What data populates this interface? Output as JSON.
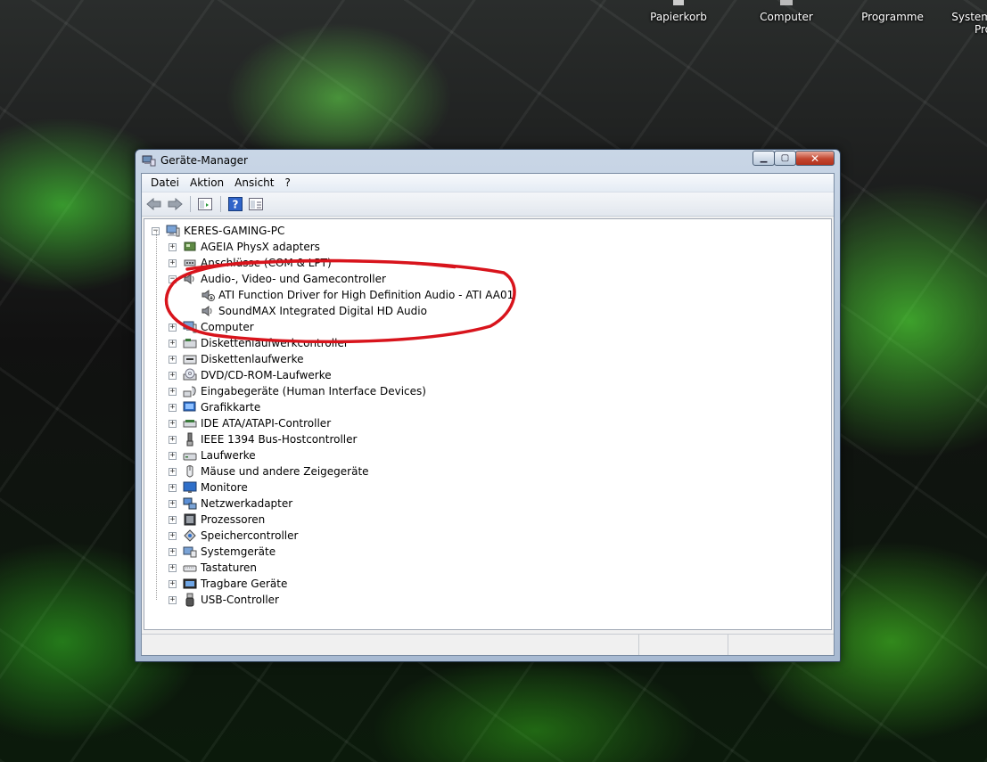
{
  "desktop": {
    "icons": [
      {
        "label": "Papierkorb",
        "icon": "recycle-bin-icon"
      },
      {
        "label": "Computer",
        "icon": "computer-icon"
      },
      {
        "label": "Programme",
        "icon": "folder-icon"
      },
      {
        "label": "System",
        "label2": "Pro",
        "icon": "system-icon"
      }
    ]
  },
  "window": {
    "title": "Geräte-Manager",
    "menu": [
      "Datei",
      "Aktion",
      "Ansicht",
      "?"
    ],
    "toolbar": [
      "back-arrow-icon",
      "forward-arrow-icon",
      "properties-icon",
      "help-icon",
      "view-icon"
    ]
  },
  "tree": {
    "root": "KERES-GAMING-PC",
    "items": [
      {
        "label": "AGEIA PhysX adapters",
        "expander": "+",
        "icon": "physx-adapter-icon"
      },
      {
        "label": "Anschlüsse (COM & LPT)",
        "expander": "+",
        "icon": "port-icon"
      },
      {
        "label": "Audio-, Video- und Gamecontroller",
        "expander": "-",
        "icon": "speaker-icon",
        "children": [
          {
            "label": "ATI Function Driver for High Definition Audio - ATI AA01",
            "icon": "audio-driver-icon"
          },
          {
            "label": "SoundMAX Integrated Digital HD Audio",
            "icon": "speaker-icon"
          }
        ]
      },
      {
        "label": "Computer",
        "expander": "+",
        "icon": "computer-icon"
      },
      {
        "label": "Diskettenlaufwerkcontroller",
        "expander": "+",
        "icon": "floppy-controller-icon"
      },
      {
        "label": "Diskettenlaufwerke",
        "expander": "+",
        "icon": "floppy-drive-icon"
      },
      {
        "label": "DVD/CD-ROM-Laufwerke",
        "expander": "+",
        "icon": "dvd-drive-icon"
      },
      {
        "label": "Eingabegeräte (Human Interface Devices)",
        "expander": "+",
        "icon": "hid-icon"
      },
      {
        "label": "Grafikkarte",
        "expander": "+",
        "icon": "display-adapter-icon"
      },
      {
        "label": "IDE ATA/ATAPI-Controller",
        "expander": "+",
        "icon": "ide-controller-icon"
      },
      {
        "label": "IEEE 1394 Bus-Hostcontroller",
        "expander": "+",
        "icon": "firewire-icon"
      },
      {
        "label": "Laufwerke",
        "expander": "+",
        "icon": "disk-drive-icon"
      },
      {
        "label": "Mäuse und andere Zeigegeräte",
        "expander": "+",
        "icon": "mouse-icon"
      },
      {
        "label": "Monitore",
        "expander": "+",
        "icon": "monitor-icon"
      },
      {
        "label": "Netzwerkadapter",
        "expander": "+",
        "icon": "network-adapter-icon"
      },
      {
        "label": "Prozessoren",
        "expander": "+",
        "icon": "processor-icon"
      },
      {
        "label": "Speichercontroller",
        "expander": "+",
        "icon": "storage-controller-icon"
      },
      {
        "label": "Systemgeräte",
        "expander": "+",
        "icon": "system-devices-icon"
      },
      {
        "label": "Tastaturen",
        "expander": "+",
        "icon": "keyboard-icon"
      },
      {
        "label": "Tragbare Geräte",
        "expander": "+",
        "icon": "portable-device-icon"
      },
      {
        "label": "USB-Controller",
        "expander": "+",
        "icon": "usb-icon"
      }
    ]
  },
  "colors": {
    "annotation": "#d8141c",
    "accent": "#1f6fd1"
  }
}
